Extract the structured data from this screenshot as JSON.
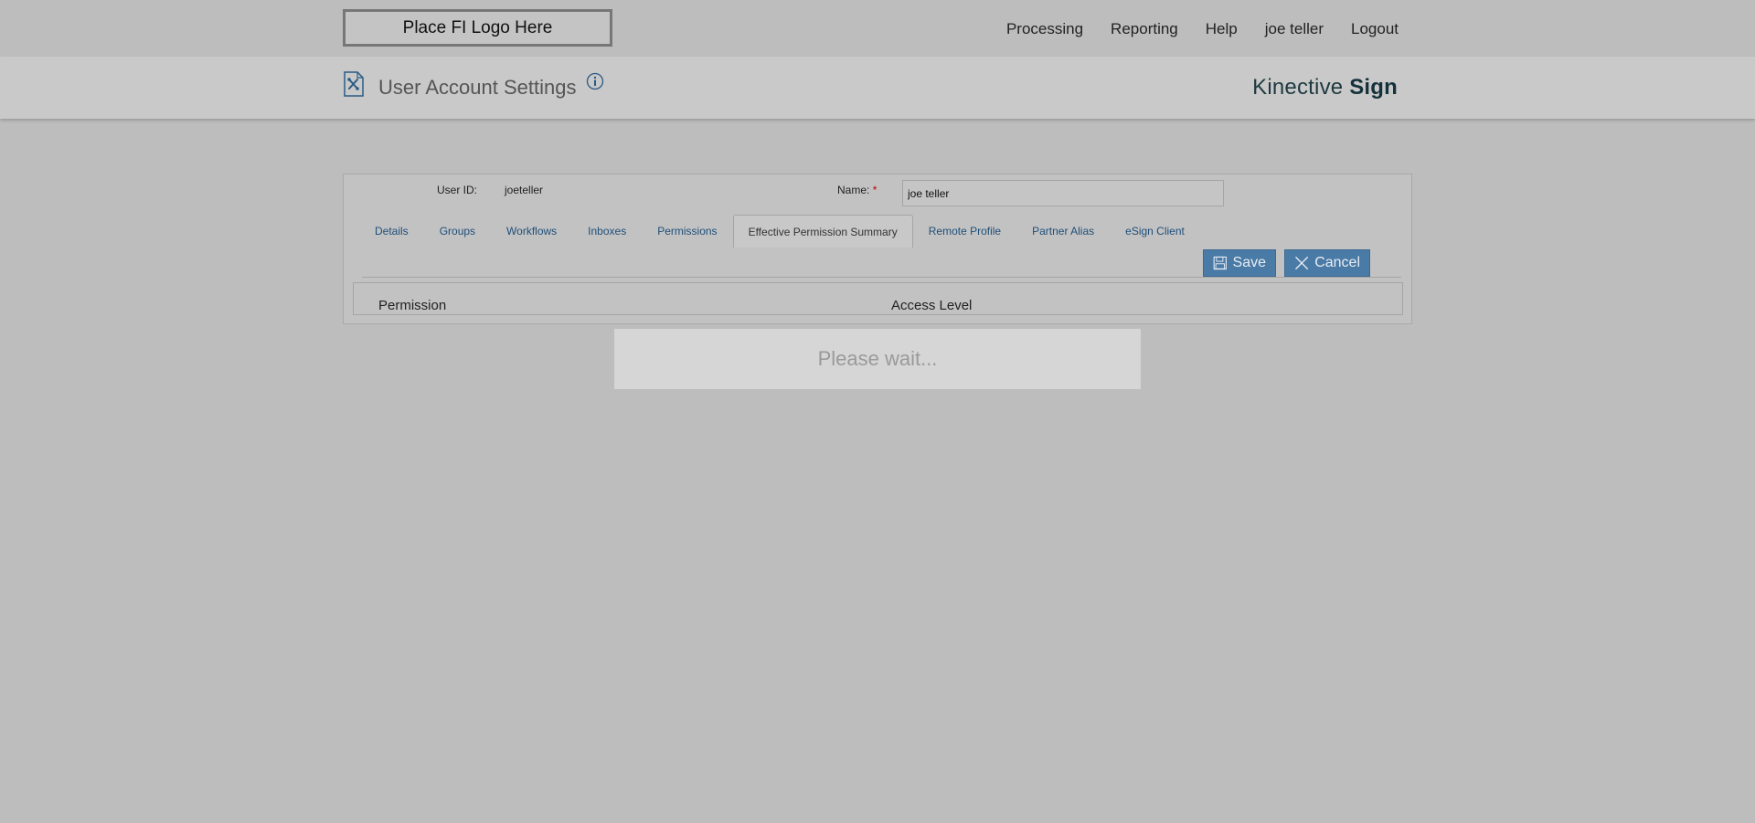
{
  "header": {
    "logo_text": "Place FI Logo Here",
    "nav": {
      "processing": "Processing",
      "reporting": "Reporting",
      "help": "Help",
      "user": "joe teller",
      "logout": "Logout"
    }
  },
  "subheader": {
    "page_title": "User Account Settings",
    "brand_regular": "Kinective ",
    "brand_bold": "Sign"
  },
  "form": {
    "user_id_label": "User ID:",
    "user_id_value": "joeteller",
    "name_label": "Name:",
    "name_required_marker": "*",
    "name_value": "joe teller"
  },
  "tabs": {
    "details": "Details",
    "groups": "Groups",
    "workflows": "Workflows",
    "inboxes": "Inboxes",
    "permissions": "Permissions",
    "effective_permission_summary": "Effective Permission Summary",
    "remote_profile": "Remote Profile",
    "partner_alias": "Partner Alias",
    "esign_client": "eSign Client"
  },
  "actions": {
    "save": "Save",
    "cancel": "Cancel"
  },
  "table": {
    "col_permission": "Permission",
    "col_access_level": "Access Level"
  },
  "overlay": {
    "message": "Please wait..."
  },
  "colors": {
    "background": "#bdbdbd",
    "button": "#4a7aa6",
    "tab_link": "#1f4f7a",
    "brand": "#1e3a40"
  }
}
